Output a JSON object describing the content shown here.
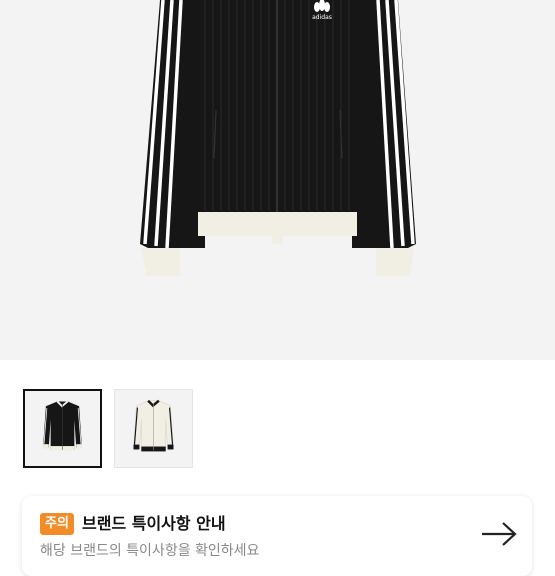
{
  "product_images": {
    "hero_alt": "product-hero",
    "logo_text": "adidas",
    "thumbnails": [
      {
        "name": "thumbnail-black-jacket",
        "selected": true
      },
      {
        "name": "thumbnail-cream-jacket",
        "selected": false
      }
    ]
  },
  "notice": {
    "badge_label": "주의",
    "title": "브랜드 특이사항 안내",
    "subtitle": "해당 브랜드의 특이사항을 확인하세요",
    "arrow_icon": "arrow-right-icon"
  },
  "colors": {
    "badge": "#f28c28",
    "jacket_body": "#161616",
    "jacket_trim": "#f1eee4"
  }
}
